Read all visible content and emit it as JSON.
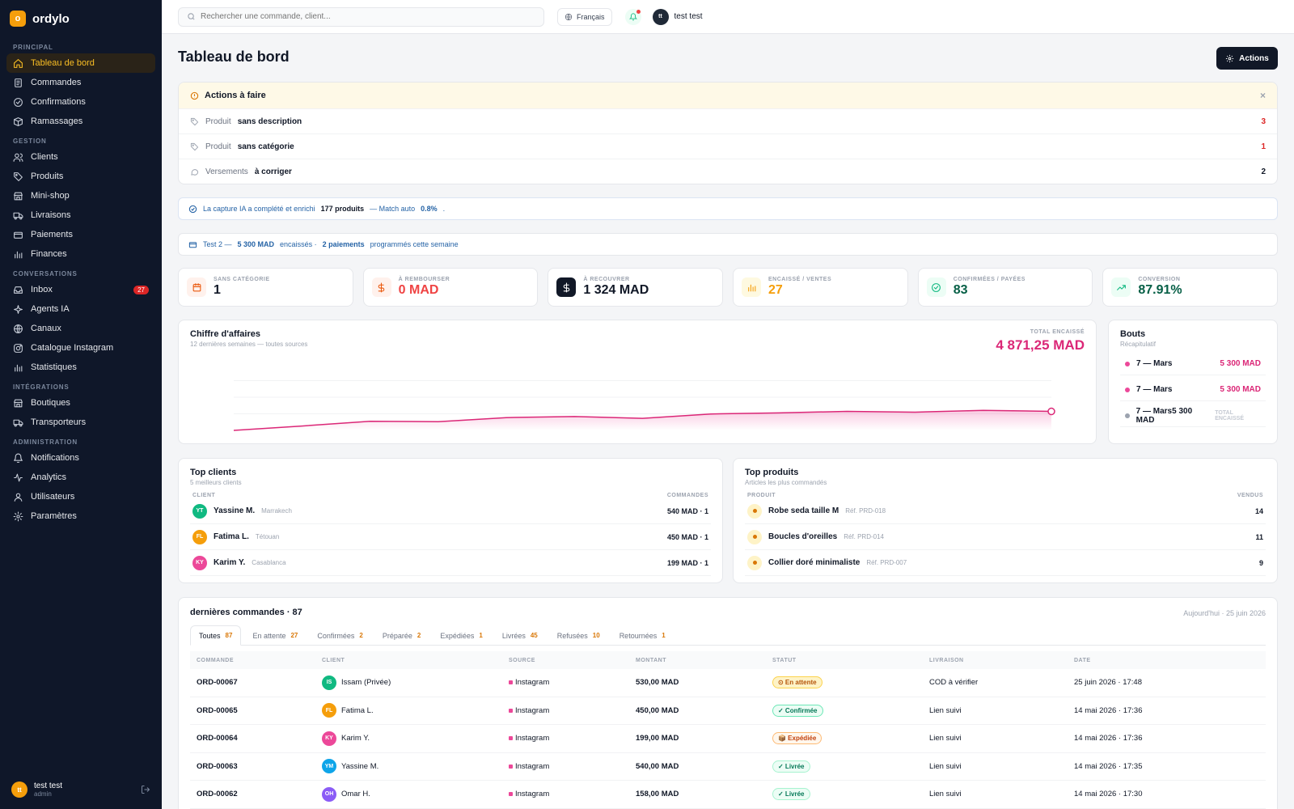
{
  "app": {
    "name": "ordylo",
    "logo_letter": "o"
  },
  "sidebar": {
    "sections": [
      {
        "title": "PRINCIPAL",
        "items": [
          {
            "label": "Tableau de bord",
            "icon": "home-icon",
            "active": true
          },
          {
            "label": "Commandes",
            "icon": "receipt-icon"
          },
          {
            "label": "Confirmations",
            "icon": "check-circle-icon"
          },
          {
            "label": "Ramassages",
            "icon": "box-icon"
          }
        ]
      },
      {
        "title": "GESTION",
        "items": [
          {
            "label": "Clients",
            "icon": "users-icon"
          },
          {
            "label": "Produits",
            "icon": "tag-icon"
          },
          {
            "label": "Mini-shop",
            "icon": "store-icon"
          },
          {
            "label": "Livraisons",
            "icon": "truck-icon"
          },
          {
            "label": "Paiements",
            "icon": "card-icon"
          },
          {
            "label": "Finances",
            "icon": "bar-chart-icon"
          }
        ]
      },
      {
        "title": "CONVERSATIONS",
        "items": [
          {
            "label": "Inbox",
            "icon": "inbox-icon",
            "badge": "27"
          },
          {
            "label": "Agents IA",
            "icon": "sparkle-icon"
          },
          {
            "label": "Canaux",
            "icon": "globe-icon"
          },
          {
            "label": "Catalogue Instagram",
            "icon": "instagram-icon"
          },
          {
            "label": "Statistiques",
            "icon": "bar-chart-icon"
          }
        ]
      },
      {
        "title": "INTÉGRATIONS",
        "items": [
          {
            "label": "Boutiques",
            "icon": "store-icon"
          },
          {
            "label": "Transporteurs",
            "icon": "truck-icon"
          }
        ]
      },
      {
        "title": "ADMINISTRATION",
        "items": [
          {
            "label": "Notifications",
            "icon": "bell-icon"
          },
          {
            "label": "Analytics",
            "icon": "activity-icon"
          },
          {
            "label": "Utilisateurs",
            "icon": "user-icon"
          },
          {
            "label": "Paramètres",
            "icon": "gear-icon"
          }
        ]
      }
    ],
    "user": {
      "initials": "tt",
      "name": "test test",
      "role": "admin"
    }
  },
  "topbar": {
    "search_placeholder": "Rechercher une commande, client...",
    "language": "Français",
    "user_initials": "tt",
    "user_name": "test test"
  },
  "page": {
    "title": "Tableau de bord",
    "actions_label": "Actions"
  },
  "todo": {
    "title": "Actions à faire",
    "close": "×",
    "rows": [
      {
        "icon": "tag-icon",
        "key": "Produit",
        "value": "sans description",
        "count": "3",
        "count_color": "#dc2626"
      },
      {
        "icon": "tag-icon",
        "key": "Produit",
        "value": "sans catégorie",
        "count": "1",
        "count_color": "#dc2626"
      },
      {
        "icon": "message-icon",
        "key": "Versements",
        "value": "à corriger",
        "count": "2",
        "count_color": "#111827"
      }
    ]
  },
  "ai_banner": {
    "text1": "La capture IA a complété et enrichi",
    "products": "177 produits",
    "text2": "— Match auto",
    "rate": "0.8%",
    "end": "."
  },
  "payment_banner": {
    "text1": "Test 2 —",
    "amount": "5 300 MAD",
    "text2": "encaissés ·",
    "payments": "2 paiements",
    "text3": "programmés cette semaine"
  },
  "kpis": [
    {
      "label": "SANS CATÉGORIE",
      "value": "1",
      "icon": "calendar-icon",
      "icon_bg": "#fff1ec",
      "icon_color": "#ea580c",
      "value_color": "#111827"
    },
    {
      "label": "À REMBOURSER",
      "value": "0 MAD",
      "icon": "dollar-icon",
      "icon_bg": "#fff1ec",
      "icon_color": "#ea580c",
      "value_color": "#ef4444"
    },
    {
      "label": "À RECOUVRER",
      "value": "1 324 MAD",
      "icon": "dollar-icon",
      "icon_bg": "#111827",
      "icon_color": "#ffffff",
      "value_color": "#111827"
    },
    {
      "label": "ENCAISSÉ / VENTES",
      "value": "27",
      "icon": "bar-chart-icon",
      "icon_bg": "#fef9e0",
      "icon_color": "#f59e0b",
      "value_color": "#f59e0b"
    },
    {
      "label": "CONFIRMÉES / PAYÉES",
      "value": "83",
      "icon": "check-circle-icon",
      "icon_bg": "#ecfdf5",
      "icon_color": "#10b981",
      "value_color": "#065f46"
    },
    {
      "label": "CONVERSION",
      "value": "87.91%",
      "icon": "trending-up-icon",
      "icon_bg": "#ecfdf5",
      "icon_color": "#10b981",
      "value_color": "#065f46"
    }
  ],
  "revenue": {
    "title": "Chiffre d'affaires",
    "subtitle": "12 dernières semaines — toutes sources",
    "total_label": "TOTAL ENCAISSÉ",
    "total": "4 871,25 MAD",
    "color": "#db2777"
  },
  "chart_data": {
    "type": "area",
    "x": [
      1,
      2,
      3,
      4,
      5,
      6,
      7,
      8,
      9,
      10,
      11,
      12,
      13
    ],
    "values": [
      0,
      12,
      25,
      24,
      35,
      38,
      33,
      45,
      48,
      52,
      50,
      55,
      52
    ],
    "title": "Chiffre d'affaires",
    "xlabel": "",
    "ylabel": "",
    "ylim": [
      0,
      100
    ],
    "grid": true
  },
  "bouts": {
    "title": "Bouts",
    "subtitle": "Récapitulatif",
    "rows": [
      {
        "label": "7 — Mars",
        "amount": "5 300 MAD",
        "dot": "#ec4899"
      },
      {
        "label": "7 — Mars",
        "amount": "5 300 MAD",
        "dot": "#ec4899"
      },
      {
        "label": "7 — Mars5 300 MAD",
        "ghost": "TOTAL ENCAISSÉ",
        "dot": "#9ca3af"
      }
    ]
  },
  "top_clients": {
    "title": "Top clients",
    "subtitle": "5 meilleurs clients",
    "col1": "CLIENT",
    "col2": "COMMANDES",
    "rows": [
      {
        "initials": "YT",
        "name": "Yassine M.",
        "city": "Marrakech",
        "value": "540 MAD · 1",
        "color": "#10b981"
      },
      {
        "initials": "FL",
        "name": "Fatima L.",
        "city": "Tétouan",
        "value": "450 MAD · 1",
        "color": "#f59e0b"
      },
      {
        "initials": "KY",
        "name": "Karim Y.",
        "city": "Casablanca",
        "value": "199 MAD · 1",
        "color": "#ec4899"
      }
    ]
  },
  "top_products": {
    "title": "Top produits",
    "subtitle": "Articles les plus commandés",
    "col1": "PRODUIT",
    "col2": "VENDUS",
    "rows": [
      {
        "name": "Robe seda taille M",
        "ref": "Réf. PRD-018",
        "value": "14"
      },
      {
        "name": "Boucles d'oreilles",
        "ref": "Réf. PRD-014",
        "value": "11"
      },
      {
        "name": "Collier doré minimaliste",
        "ref": "Réf. PRD-007",
        "value": "9"
      }
    ]
  },
  "orders": {
    "title": "dernières commandes · 87",
    "date": "Aujourd'hui · 25 juin 2026",
    "tabs": [
      {
        "label": "Toutes",
        "count": "87",
        "active": true
      },
      {
        "label": "En attente",
        "count": "27"
      },
      {
        "label": "Confirmées",
        "count": "2"
      },
      {
        "label": "Préparée",
        "count": "2"
      },
      {
        "label": "Expédiées",
        "count": "1"
      },
      {
        "label": "Livrées",
        "count": "45"
      },
      {
        "label": "Refusées",
        "count": "10"
      },
      {
        "label": "Retournées",
        "count": "1"
      }
    ],
    "columns": [
      "COMMANDE",
      "CLIENT",
      "SOURCE",
      "MONTANT",
      "STATUT",
      "LIVRAISON",
      "DATE"
    ],
    "rows": [
      {
        "id": "ORD-00067",
        "initials": "IS",
        "client": "Issam (Privée)",
        "color": "#10b981",
        "source": "Instagram",
        "amount": "530,00 MAD",
        "status": "⊙ En attente",
        "status_class": "p-wait",
        "delivery": "COD à vérifier",
        "date": "25 juin 2026 · 17:48"
      },
      {
        "id": "ORD-00065",
        "initials": "FL",
        "client": "Fatima L.",
        "color": "#f59e0b",
        "source": "Instagram",
        "amount": "450,00 MAD",
        "status": "✓ Confirmée",
        "status_class": "p-conf",
        "delivery": "Lien suivi",
        "date": "14 mai 2026 · 17:36"
      },
      {
        "id": "ORD-00064",
        "initials": "KY",
        "client": "Karim Y.",
        "color": "#ec4899",
        "source": "Instagram",
        "amount": "199,00 MAD",
        "status": "📦 Expédiée",
        "status_class": "p-exp",
        "delivery": "Lien suivi",
        "date": "14 mai 2026 · 17:36"
      },
      {
        "id": "ORD-00063",
        "initials": "YM",
        "client": "Yassine M.",
        "color": "#0ea5e9",
        "source": "Instagram",
        "amount": "540,00 MAD",
        "status": "✓ Livrée",
        "status_class": "p-liv",
        "delivery": "Lien suivi",
        "date": "14 mai 2026 · 17:35"
      },
      {
        "id": "ORD-00062",
        "initials": "OH",
        "client": "Omar H.",
        "color": "#8b5cf6",
        "source": "Instagram",
        "amount": "158,00 MAD",
        "status": "✓ Livrée",
        "status_class": "p-liv",
        "delivery": "Lien suivi",
        "date": "14 mai 2026 · 17:30"
      }
    ]
  }
}
